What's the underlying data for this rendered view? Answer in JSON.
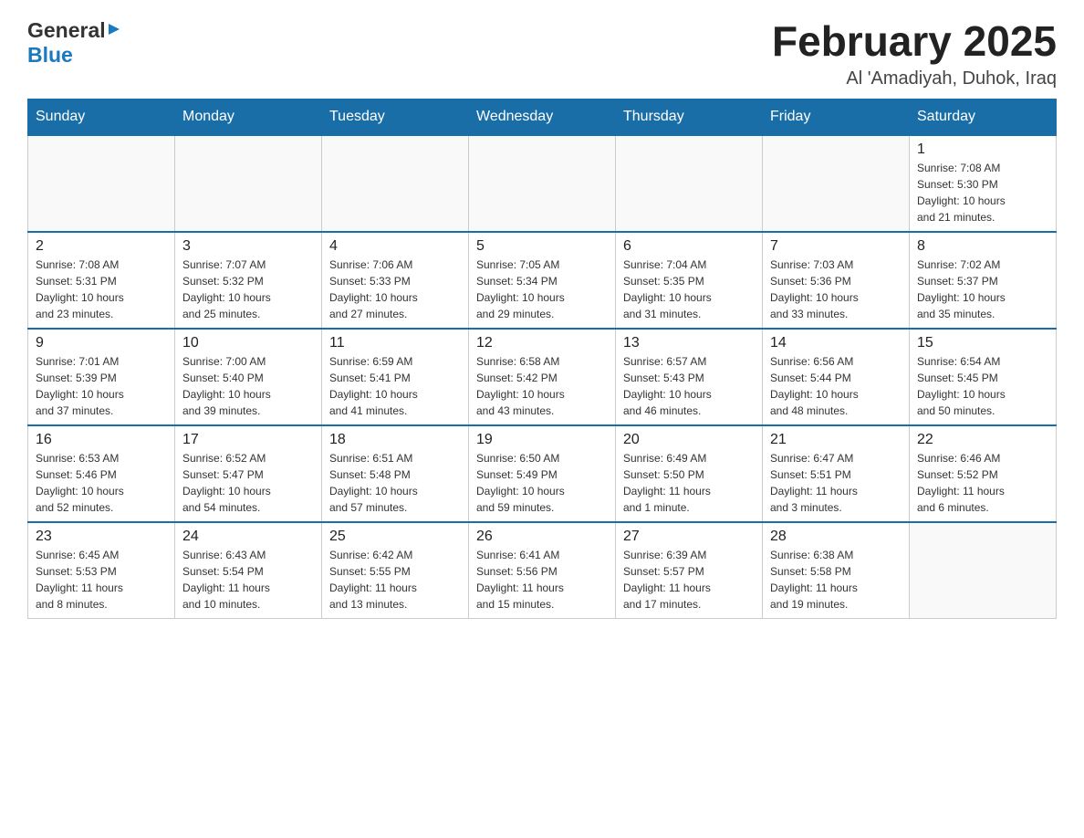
{
  "header": {
    "logo_general": "General",
    "logo_blue": "Blue",
    "month_title": "February 2025",
    "location": "Al 'Amadiyah, Duhok, Iraq"
  },
  "weekdays": [
    "Sunday",
    "Monday",
    "Tuesday",
    "Wednesday",
    "Thursday",
    "Friday",
    "Saturday"
  ],
  "weeks": [
    [
      {
        "day": "",
        "info": ""
      },
      {
        "day": "",
        "info": ""
      },
      {
        "day": "",
        "info": ""
      },
      {
        "day": "",
        "info": ""
      },
      {
        "day": "",
        "info": ""
      },
      {
        "day": "",
        "info": ""
      },
      {
        "day": "1",
        "info": "Sunrise: 7:08 AM\nSunset: 5:30 PM\nDaylight: 10 hours\nand 21 minutes."
      }
    ],
    [
      {
        "day": "2",
        "info": "Sunrise: 7:08 AM\nSunset: 5:31 PM\nDaylight: 10 hours\nand 23 minutes."
      },
      {
        "day": "3",
        "info": "Sunrise: 7:07 AM\nSunset: 5:32 PM\nDaylight: 10 hours\nand 25 minutes."
      },
      {
        "day": "4",
        "info": "Sunrise: 7:06 AM\nSunset: 5:33 PM\nDaylight: 10 hours\nand 27 minutes."
      },
      {
        "day": "5",
        "info": "Sunrise: 7:05 AM\nSunset: 5:34 PM\nDaylight: 10 hours\nand 29 minutes."
      },
      {
        "day": "6",
        "info": "Sunrise: 7:04 AM\nSunset: 5:35 PM\nDaylight: 10 hours\nand 31 minutes."
      },
      {
        "day": "7",
        "info": "Sunrise: 7:03 AM\nSunset: 5:36 PM\nDaylight: 10 hours\nand 33 minutes."
      },
      {
        "day": "8",
        "info": "Sunrise: 7:02 AM\nSunset: 5:37 PM\nDaylight: 10 hours\nand 35 minutes."
      }
    ],
    [
      {
        "day": "9",
        "info": "Sunrise: 7:01 AM\nSunset: 5:39 PM\nDaylight: 10 hours\nand 37 minutes."
      },
      {
        "day": "10",
        "info": "Sunrise: 7:00 AM\nSunset: 5:40 PM\nDaylight: 10 hours\nand 39 minutes."
      },
      {
        "day": "11",
        "info": "Sunrise: 6:59 AM\nSunset: 5:41 PM\nDaylight: 10 hours\nand 41 minutes."
      },
      {
        "day": "12",
        "info": "Sunrise: 6:58 AM\nSunset: 5:42 PM\nDaylight: 10 hours\nand 43 minutes."
      },
      {
        "day": "13",
        "info": "Sunrise: 6:57 AM\nSunset: 5:43 PM\nDaylight: 10 hours\nand 46 minutes."
      },
      {
        "day": "14",
        "info": "Sunrise: 6:56 AM\nSunset: 5:44 PM\nDaylight: 10 hours\nand 48 minutes."
      },
      {
        "day": "15",
        "info": "Sunrise: 6:54 AM\nSunset: 5:45 PM\nDaylight: 10 hours\nand 50 minutes."
      }
    ],
    [
      {
        "day": "16",
        "info": "Sunrise: 6:53 AM\nSunset: 5:46 PM\nDaylight: 10 hours\nand 52 minutes."
      },
      {
        "day": "17",
        "info": "Sunrise: 6:52 AM\nSunset: 5:47 PM\nDaylight: 10 hours\nand 54 minutes."
      },
      {
        "day": "18",
        "info": "Sunrise: 6:51 AM\nSunset: 5:48 PM\nDaylight: 10 hours\nand 57 minutes."
      },
      {
        "day": "19",
        "info": "Sunrise: 6:50 AM\nSunset: 5:49 PM\nDaylight: 10 hours\nand 59 minutes."
      },
      {
        "day": "20",
        "info": "Sunrise: 6:49 AM\nSunset: 5:50 PM\nDaylight: 11 hours\nand 1 minute."
      },
      {
        "day": "21",
        "info": "Sunrise: 6:47 AM\nSunset: 5:51 PM\nDaylight: 11 hours\nand 3 minutes."
      },
      {
        "day": "22",
        "info": "Sunrise: 6:46 AM\nSunset: 5:52 PM\nDaylight: 11 hours\nand 6 minutes."
      }
    ],
    [
      {
        "day": "23",
        "info": "Sunrise: 6:45 AM\nSunset: 5:53 PM\nDaylight: 11 hours\nand 8 minutes."
      },
      {
        "day": "24",
        "info": "Sunrise: 6:43 AM\nSunset: 5:54 PM\nDaylight: 11 hours\nand 10 minutes."
      },
      {
        "day": "25",
        "info": "Sunrise: 6:42 AM\nSunset: 5:55 PM\nDaylight: 11 hours\nand 13 minutes."
      },
      {
        "day": "26",
        "info": "Sunrise: 6:41 AM\nSunset: 5:56 PM\nDaylight: 11 hours\nand 15 minutes."
      },
      {
        "day": "27",
        "info": "Sunrise: 6:39 AM\nSunset: 5:57 PM\nDaylight: 11 hours\nand 17 minutes."
      },
      {
        "day": "28",
        "info": "Sunrise: 6:38 AM\nSunset: 5:58 PM\nDaylight: 11 hours\nand 19 minutes."
      },
      {
        "day": "",
        "info": ""
      }
    ]
  ]
}
